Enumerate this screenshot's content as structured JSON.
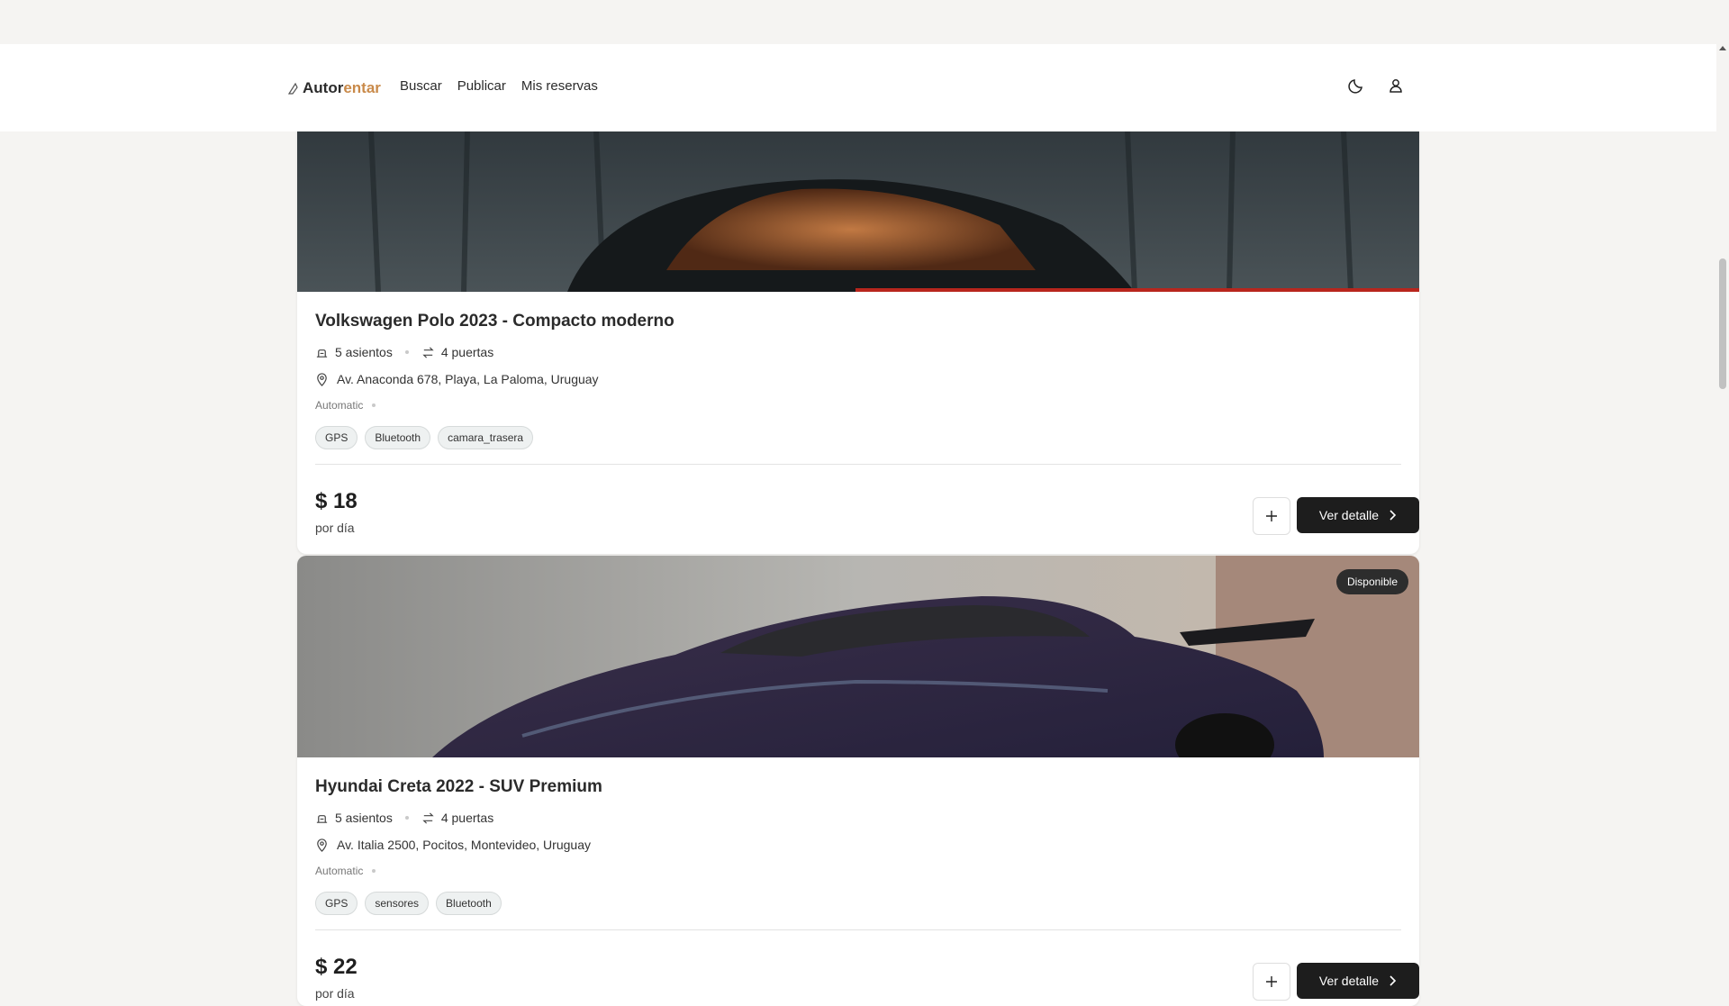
{
  "brand": {
    "part1": "Autor",
    "part2": "entar"
  },
  "nav": {
    "links": [
      "Buscar",
      "Publicar",
      "Mis reservas"
    ]
  },
  "icons": {
    "theme": "moon-icon",
    "user": "user-icon",
    "seats": "seat-icon",
    "doors": "swap-arrows-icon",
    "location": "map-pin-icon"
  },
  "cards": [
    {
      "title": "Volkswagen Polo 2023 - Compacto moderno",
      "seats": "5 asientos",
      "doors": "4 puertas",
      "location": "Av. Anaconda 678, Playa, La Paloma, Uruguay",
      "transmission": "Automatic",
      "features": [
        "GPS",
        "Bluetooth",
        "camara_trasera"
      ],
      "price": "$ 18",
      "per": "por día",
      "detail_label": "Ver detalle"
    },
    {
      "badge": "Disponible",
      "title": "Hyundai Creta 2022 - SUV Premium",
      "seats": "5 asientos",
      "doors": "4 puertas",
      "location": "Av. Italia 2500, Pocitos, Montevideo, Uruguay",
      "transmission": "Automatic",
      "features": [
        "GPS",
        "sensores",
        "Bluetooth"
      ],
      "price": "$ 22",
      "per": "por día",
      "detail_label": "Ver detalle"
    }
  ],
  "colors": {
    "accent": "#c98a4a",
    "button": "#1d1d1d",
    "badge": "#2d2d2d",
    "background": "#f5f4f2"
  }
}
